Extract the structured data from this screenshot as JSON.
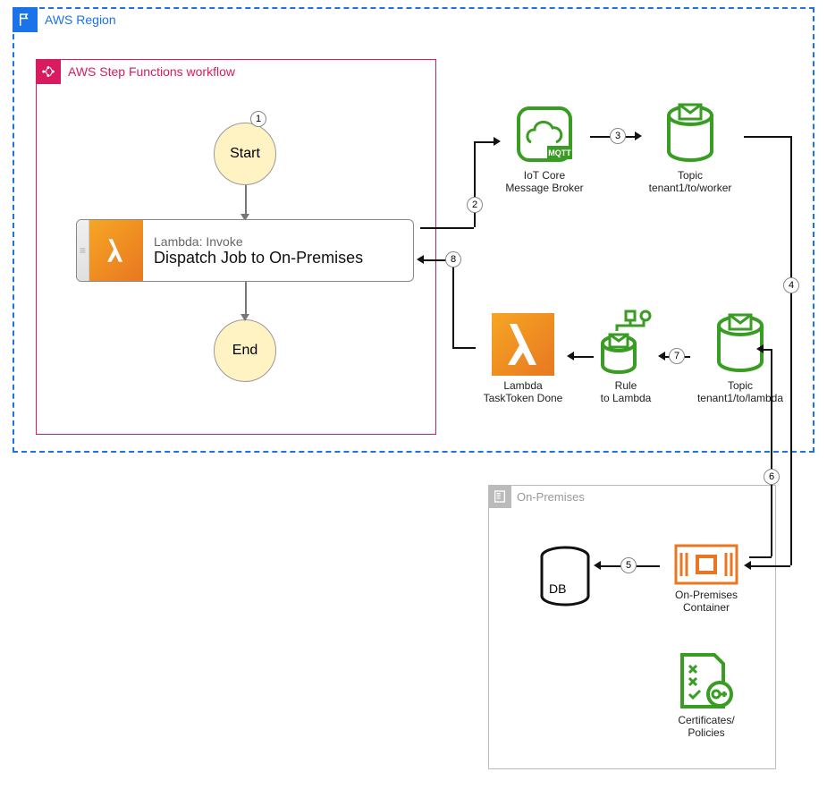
{
  "region": {
    "label": "AWS Region"
  },
  "sfn": {
    "label": "AWS Step Functions workflow",
    "start": "Start",
    "end": "End",
    "step": {
      "top": "Lambda: Invoke",
      "title": "Dispatch Job to On-Premises"
    }
  },
  "services": {
    "iot_core": {
      "line1": "IoT Core",
      "line2": "Message Broker",
      "badge": "MQTT"
    },
    "topic_worker": {
      "line1": "Topic",
      "line2": "tenant1/to/worker"
    },
    "lambda_done": {
      "line1": "Lambda",
      "line2": "TaskToken Done"
    },
    "rule": {
      "line1": "Rule",
      "line2": "to Lambda"
    },
    "topic_lambda": {
      "line1": "Topic",
      "line2": "tenant1/to/lambda"
    }
  },
  "onprem": {
    "label": "On-Premises",
    "db": "DB",
    "container": {
      "line1": "On-Premises",
      "line2": "Container"
    },
    "certs": {
      "line1": "Certificates/",
      "line2": "Policies"
    }
  },
  "steps": {
    "s1": "1",
    "s2": "2",
    "s3": "3",
    "s4": "4",
    "s5": "5",
    "s6": "6",
    "s7": "7",
    "s8": "8"
  }
}
